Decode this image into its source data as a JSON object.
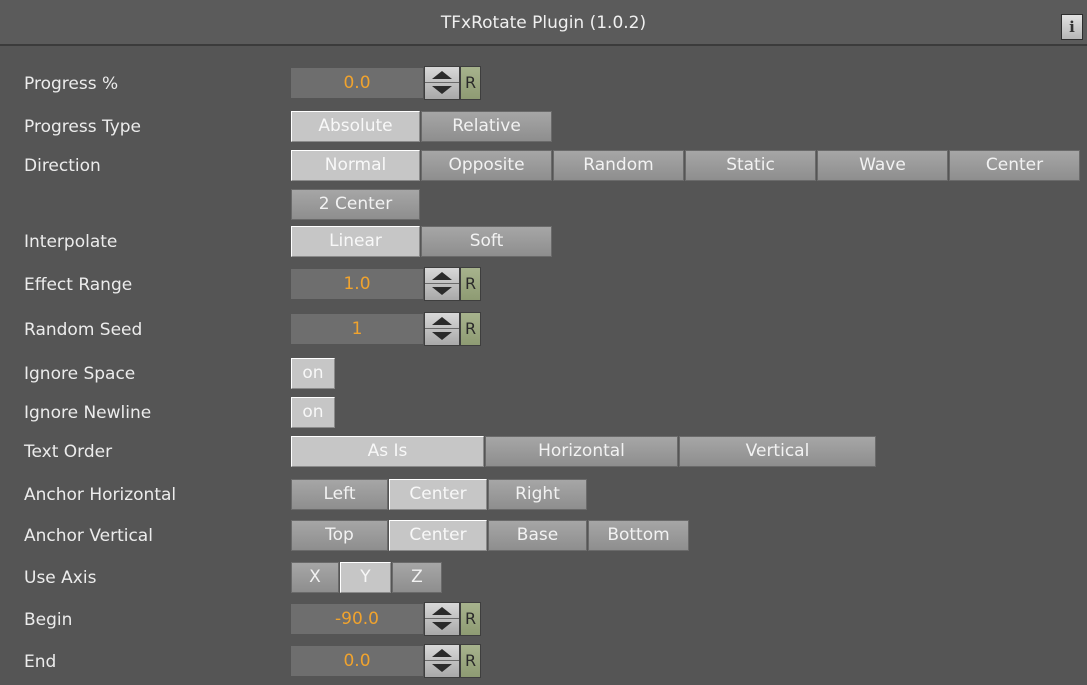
{
  "title": "TFxRotate Plugin (1.0.2)",
  "info_label": "i",
  "reset_label": "R",
  "rows": {
    "progress": {
      "label": "Progress %",
      "value": "0.0"
    },
    "progress_type": {
      "label": "Progress Type",
      "options": [
        "Absolute",
        "Relative"
      ],
      "selected": "Absolute"
    },
    "direction": {
      "label": "Direction",
      "options": [
        "Normal",
        "Opposite",
        "Random",
        "Static",
        "Wave",
        "Center",
        "2 Center"
      ],
      "selected": "Normal"
    },
    "interpolate": {
      "label": "Interpolate",
      "options": [
        "Linear",
        "Soft"
      ],
      "selected": "Linear"
    },
    "effect_range": {
      "label": "Effect Range",
      "value": "1.0"
    },
    "random_seed": {
      "label": "Random Seed",
      "value": "1"
    },
    "ignore_space": {
      "label": "Ignore Space",
      "toggle": "on"
    },
    "ignore_newline": {
      "label": "Ignore Newline",
      "toggle": "on"
    },
    "text_order": {
      "label": "Text Order",
      "options": [
        "As Is",
        "Horizontal",
        "Vertical"
      ],
      "selected": "As Is"
    },
    "anchor_horizontal": {
      "label": "Anchor Horizontal",
      "options": [
        "Left",
        "Center",
        "Right"
      ],
      "selected": "Center"
    },
    "anchor_vertical": {
      "label": "Anchor Vertical",
      "options": [
        "Top",
        "Center",
        "Base",
        "Bottom"
      ],
      "selected": "Center"
    },
    "use_axis": {
      "label": "Use Axis",
      "options": [
        "X",
        "Y",
        "Z"
      ],
      "selected": "Y"
    },
    "begin": {
      "label": "Begin",
      "value": "-90.0"
    },
    "end": {
      "label": "End",
      "value": "0.0"
    }
  },
  "colors": {
    "background": "#555555",
    "button": "#999999",
    "button_selected": "#c6c6c6",
    "value_text": "#f0a32e",
    "reset_button": "#9aa67f"
  },
  "icons": {
    "info": "info-icon",
    "spinner_up": "arrow-up-icon",
    "spinner_down": "arrow-down-icon"
  }
}
